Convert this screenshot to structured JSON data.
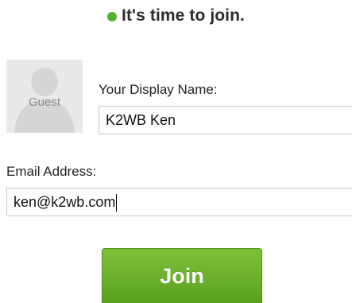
{
  "header": {
    "title": "It's time to join.",
    "status_color": "#52b22a"
  },
  "avatar": {
    "label": "Guest"
  },
  "display_name": {
    "label": "Your Display Name:",
    "value": "K2WB Ken"
  },
  "email": {
    "label": "Email Address:",
    "value": "ken@k2wb.com"
  },
  "actions": {
    "join_label": "Join",
    "join_color": "#6cb22c"
  }
}
